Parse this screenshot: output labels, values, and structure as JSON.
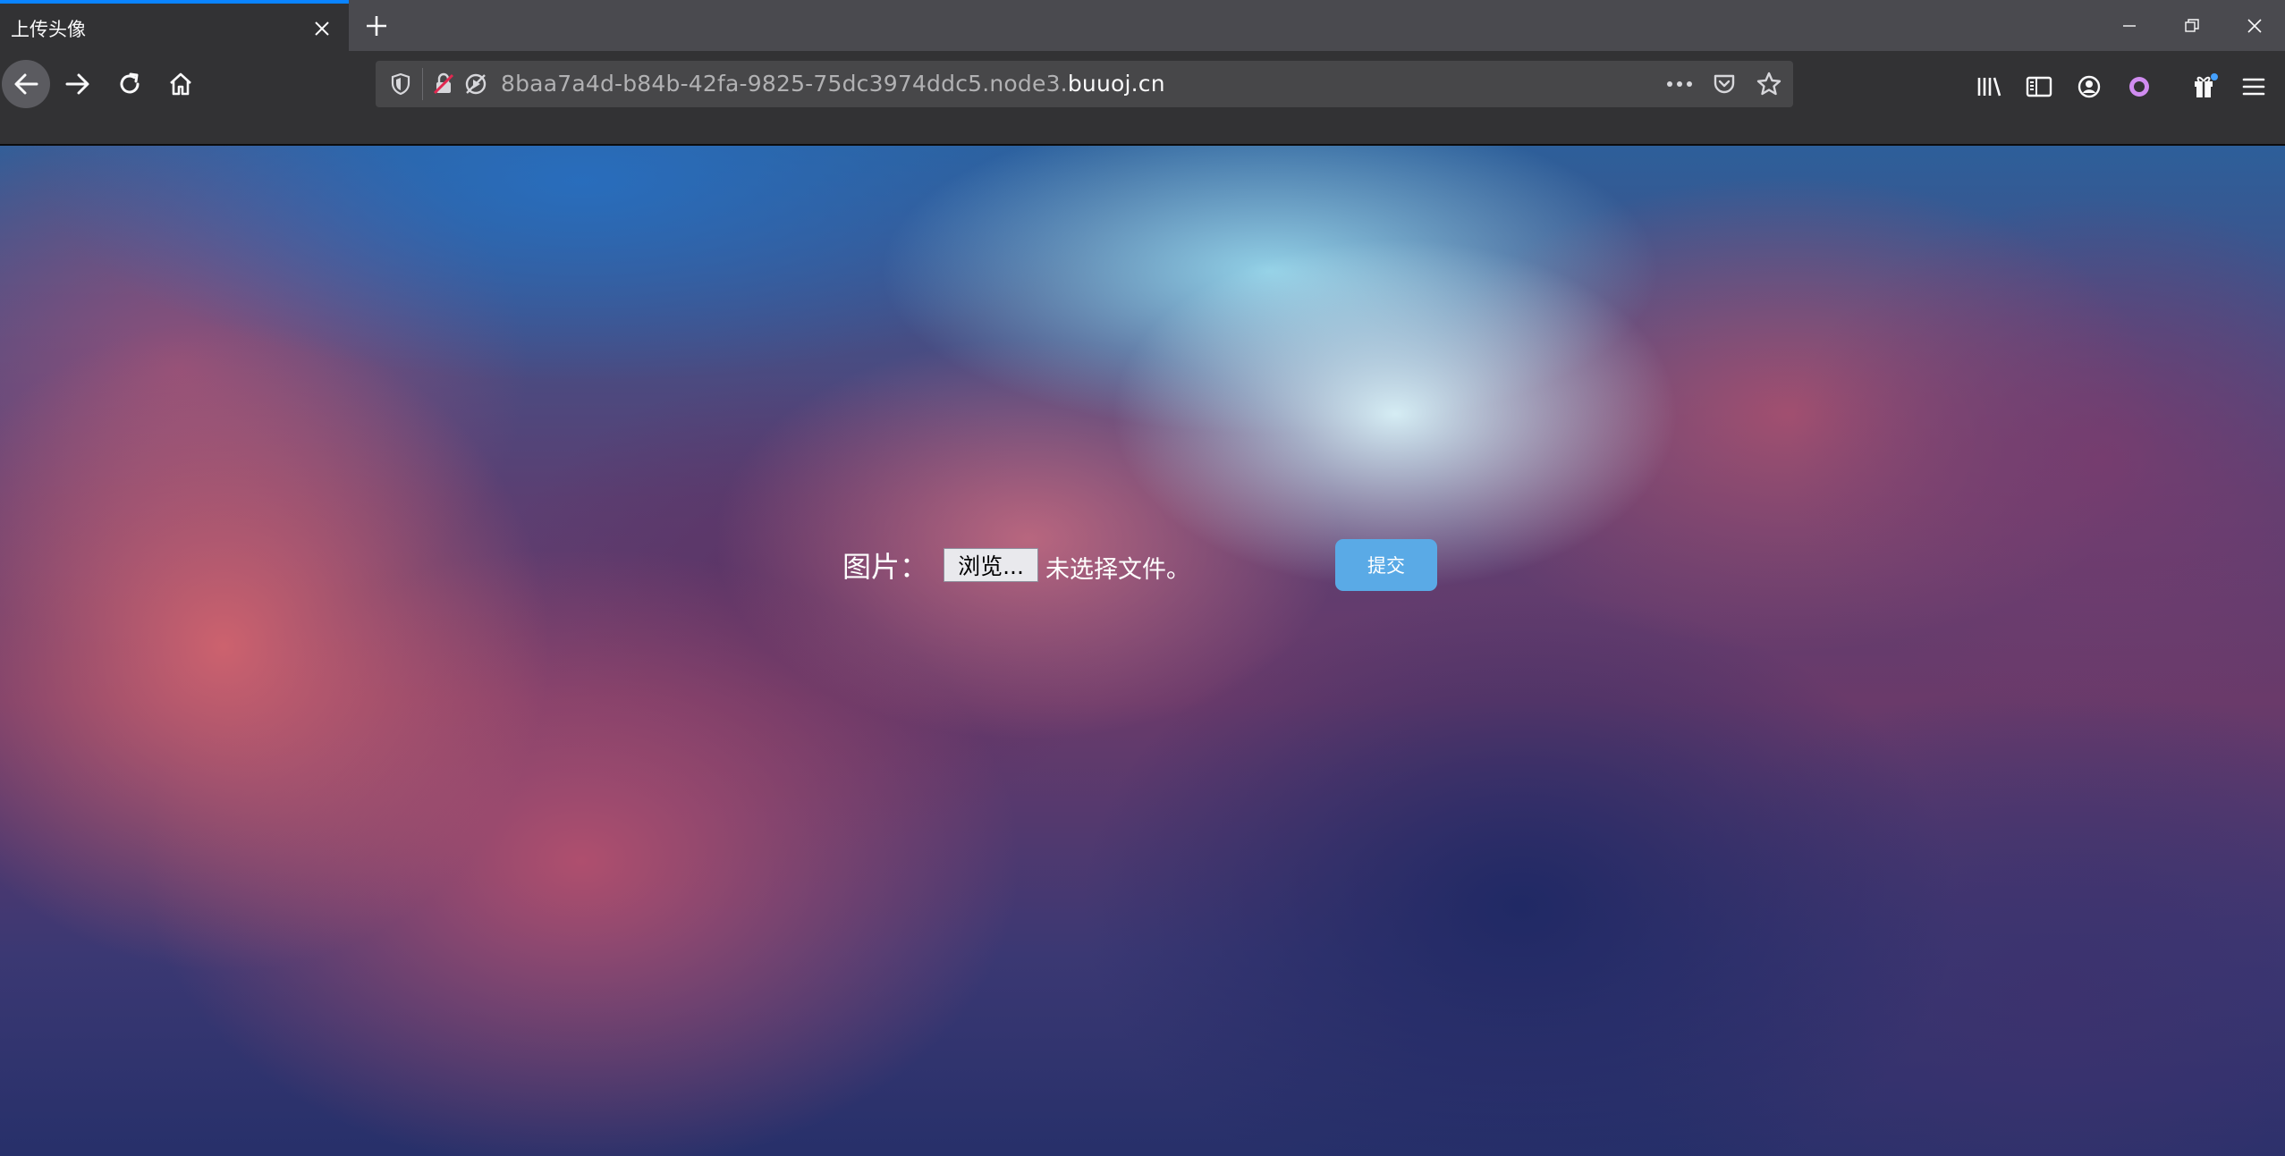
{
  "browser": {
    "tab": {
      "title": "上传头像"
    },
    "urlbar": {
      "url_subdomain": "8baa7a4d-b84b-42fa-9825-75dc3974ddc5.node3.",
      "url_domain": "buuoj.cn"
    },
    "colors": {
      "tab_accent": "#0a84ff",
      "toolbar_bg": "#323234",
      "tabstrip_bg": "#4a4a4f",
      "urlbar_bg": "#474749",
      "extension_accent": "#e0a0ff"
    }
  },
  "page": {
    "form": {
      "field_label": "图片：",
      "browse_button": "浏览...",
      "file_status": "未选择文件。",
      "submit_button": "提交"
    },
    "colors": {
      "submit_bg": "#5aaae6"
    }
  }
}
